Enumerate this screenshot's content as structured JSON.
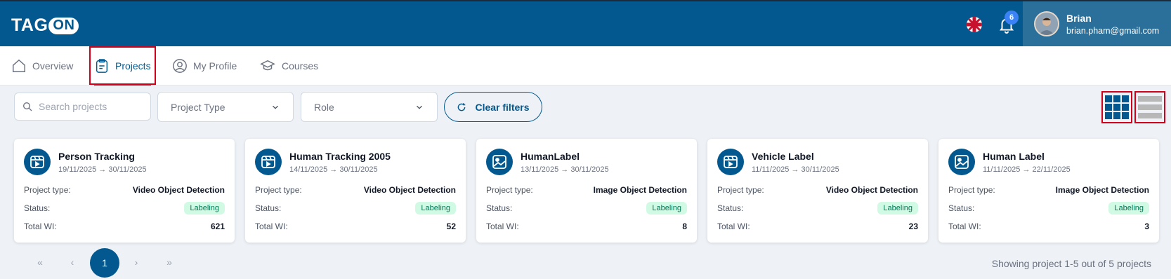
{
  "header": {
    "logo_text": "TAG",
    "logo_badge": "ON",
    "notification_count": "6",
    "user_name": "Brian",
    "user_email": "brian.pham@gmail.com"
  },
  "tabs": [
    {
      "label": "Overview",
      "icon": "home-icon"
    },
    {
      "label": "Projects",
      "icon": "clipboard-icon",
      "active": true
    },
    {
      "label": "My Profile",
      "icon": "user-circle-icon"
    },
    {
      "label": "Courses",
      "icon": "graduation-cap-icon"
    }
  ],
  "filters": {
    "search_placeholder": "Search projects",
    "project_type": "Project Type",
    "role": "Role",
    "clear_label": "Clear filters"
  },
  "labels": {
    "project_type": "Project type:",
    "status": "Status:",
    "total_wi": "Total WI:"
  },
  "projects": [
    {
      "name": "Person Tracking",
      "dates": "19/11/2025 → 30/11/2025",
      "type": "Video Object Detection",
      "status": "Labeling",
      "total": "621",
      "icon": "video-icon"
    },
    {
      "name": "Human Tracking 2005",
      "dates": "14/11/2025 → 30/11/2025",
      "type": "Video Object Detection",
      "status": "Labeling",
      "total": "52",
      "icon": "video-icon"
    },
    {
      "name": "HumanLabel",
      "dates": "13/11/2025 → 30/11/2025",
      "type": "Image Object Detection",
      "status": "Labeling",
      "total": "8",
      "icon": "image-icon"
    },
    {
      "name": "Vehicle Label",
      "dates": "11/11/2025 → 30/11/2025",
      "type": "Video Object Detection",
      "status": "Labeling",
      "total": "23",
      "icon": "video-icon"
    },
    {
      "name": "Human Label",
      "dates": "11/11/2025 → 22/11/2025",
      "type": "Image Object Detection",
      "status": "Labeling",
      "total": "3",
      "icon": "image-icon"
    }
  ],
  "pagination": {
    "first": "«",
    "prev": "‹",
    "current": "1",
    "next": "›",
    "last": "»",
    "summary": "Showing project 1-5  out of 5 projects"
  },
  "colors": {
    "brand": "#03598f",
    "status_bg": "#d1fae5",
    "highlight": "#d0021b"
  }
}
